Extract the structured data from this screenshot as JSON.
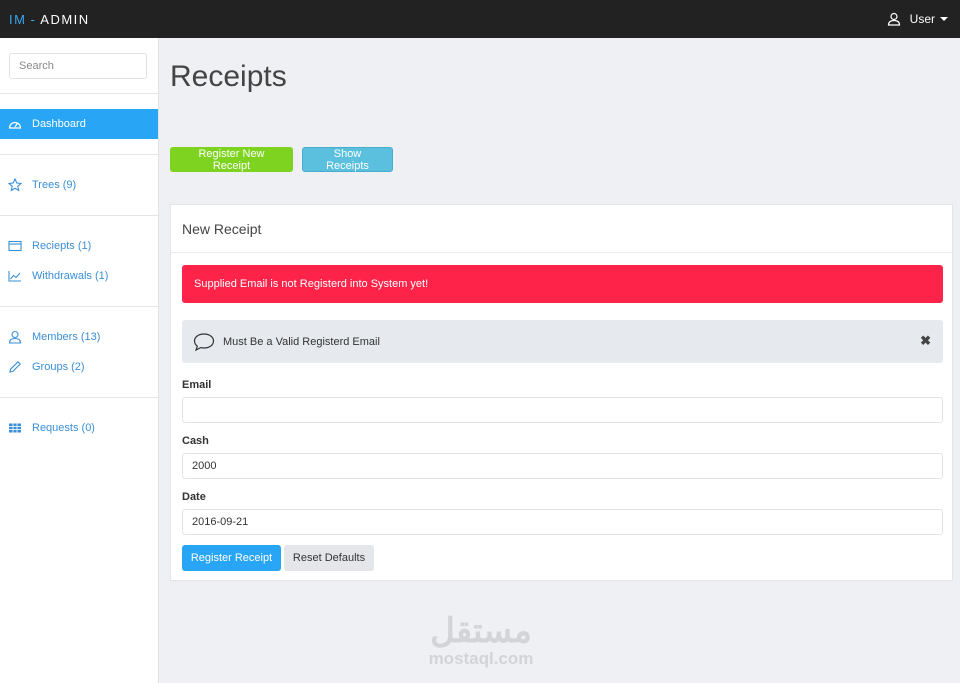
{
  "header": {
    "brand_im": "IM",
    "brand_sep": "-",
    "brand_admin": "ADMIN",
    "user_label": "User"
  },
  "sidebar": {
    "search_placeholder": "Search",
    "items": [
      {
        "label": "Dashboard",
        "icon": "dashboard-icon",
        "active": true
      },
      {
        "label": "Trees (9)",
        "icon": "star-icon"
      },
      {
        "label": "Reciepts (1)",
        "icon": "card-icon"
      },
      {
        "label": "Withdrawals (1)",
        "icon": "chart-icon"
      },
      {
        "label": "Members (13)",
        "icon": "user-icon"
      },
      {
        "label": "Groups (2)",
        "icon": "pencil-icon"
      },
      {
        "label": "Requests (0)",
        "icon": "table-icon"
      }
    ]
  },
  "main": {
    "title": "Receipts",
    "register_new_label": "Register New Receipt",
    "show_label": "Show Receipts",
    "panel_title": "New Receipt",
    "error_message": "Supplied Email is not Registerd into System yet!",
    "info_message": "Must Be a Valid Registerd Email",
    "form": {
      "email_label": "Email",
      "email_value": "",
      "cash_label": "Cash",
      "cash_value": "2000",
      "date_label": "Date",
      "date_value": "2016-09-21",
      "submit_label": "Register Receipt",
      "reset_label": "Reset Defaults"
    }
  },
  "watermark": {
    "arabic": "مستقل",
    "latin": "mostaql.com"
  },
  "colors": {
    "accent": "#29a5f5",
    "success": "#7ed321",
    "info": "#5bc0de",
    "danger": "#fe2449",
    "topbar": "#222222"
  }
}
